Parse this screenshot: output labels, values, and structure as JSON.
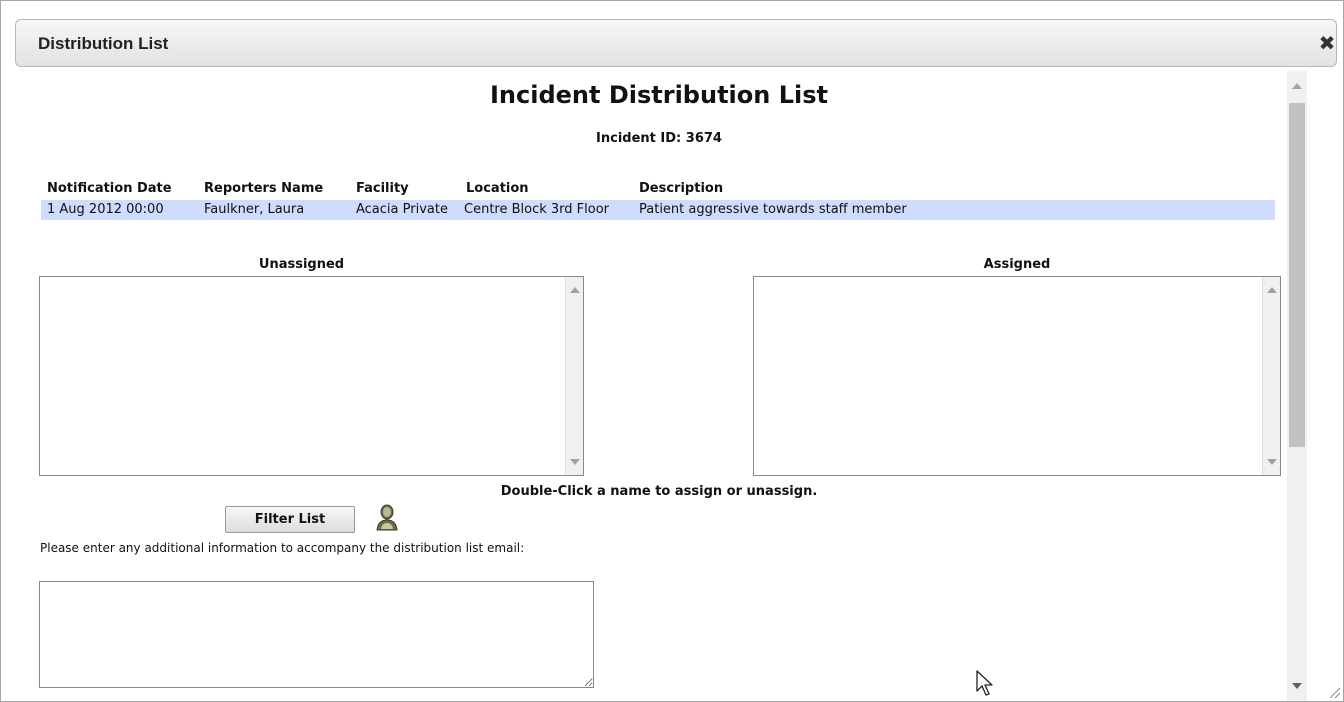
{
  "window": {
    "title": "Distribution List",
    "close_icon": "close-icon"
  },
  "page": {
    "heading": "Incident Distribution List",
    "incident_id": "Incident ID: 3674"
  },
  "table": {
    "columns": [
      "Notification Date",
      "Reporters Name",
      "Facility",
      "Location",
      "Description"
    ],
    "rows": [
      [
        "1 Aug 2012 00:00",
        "Faulkner, Laura",
        "Acacia Private",
        "Centre Block 3rd Floor",
        "Patient aggressive towards staff member"
      ]
    ],
    "row_highlight": "#cfdcfd"
  },
  "lists": {
    "unassigned_label": "Unassigned",
    "assigned_label": "Assigned",
    "unassigned_items": [],
    "assigned_items": []
  },
  "hint": "Double-Click a name to assign or unassign.",
  "filter_button": "Filter List",
  "user_icon": "person-icon",
  "additional_info": {
    "label": "Please enter any additional information to accompany the distribution list email:",
    "value": ""
  }
}
